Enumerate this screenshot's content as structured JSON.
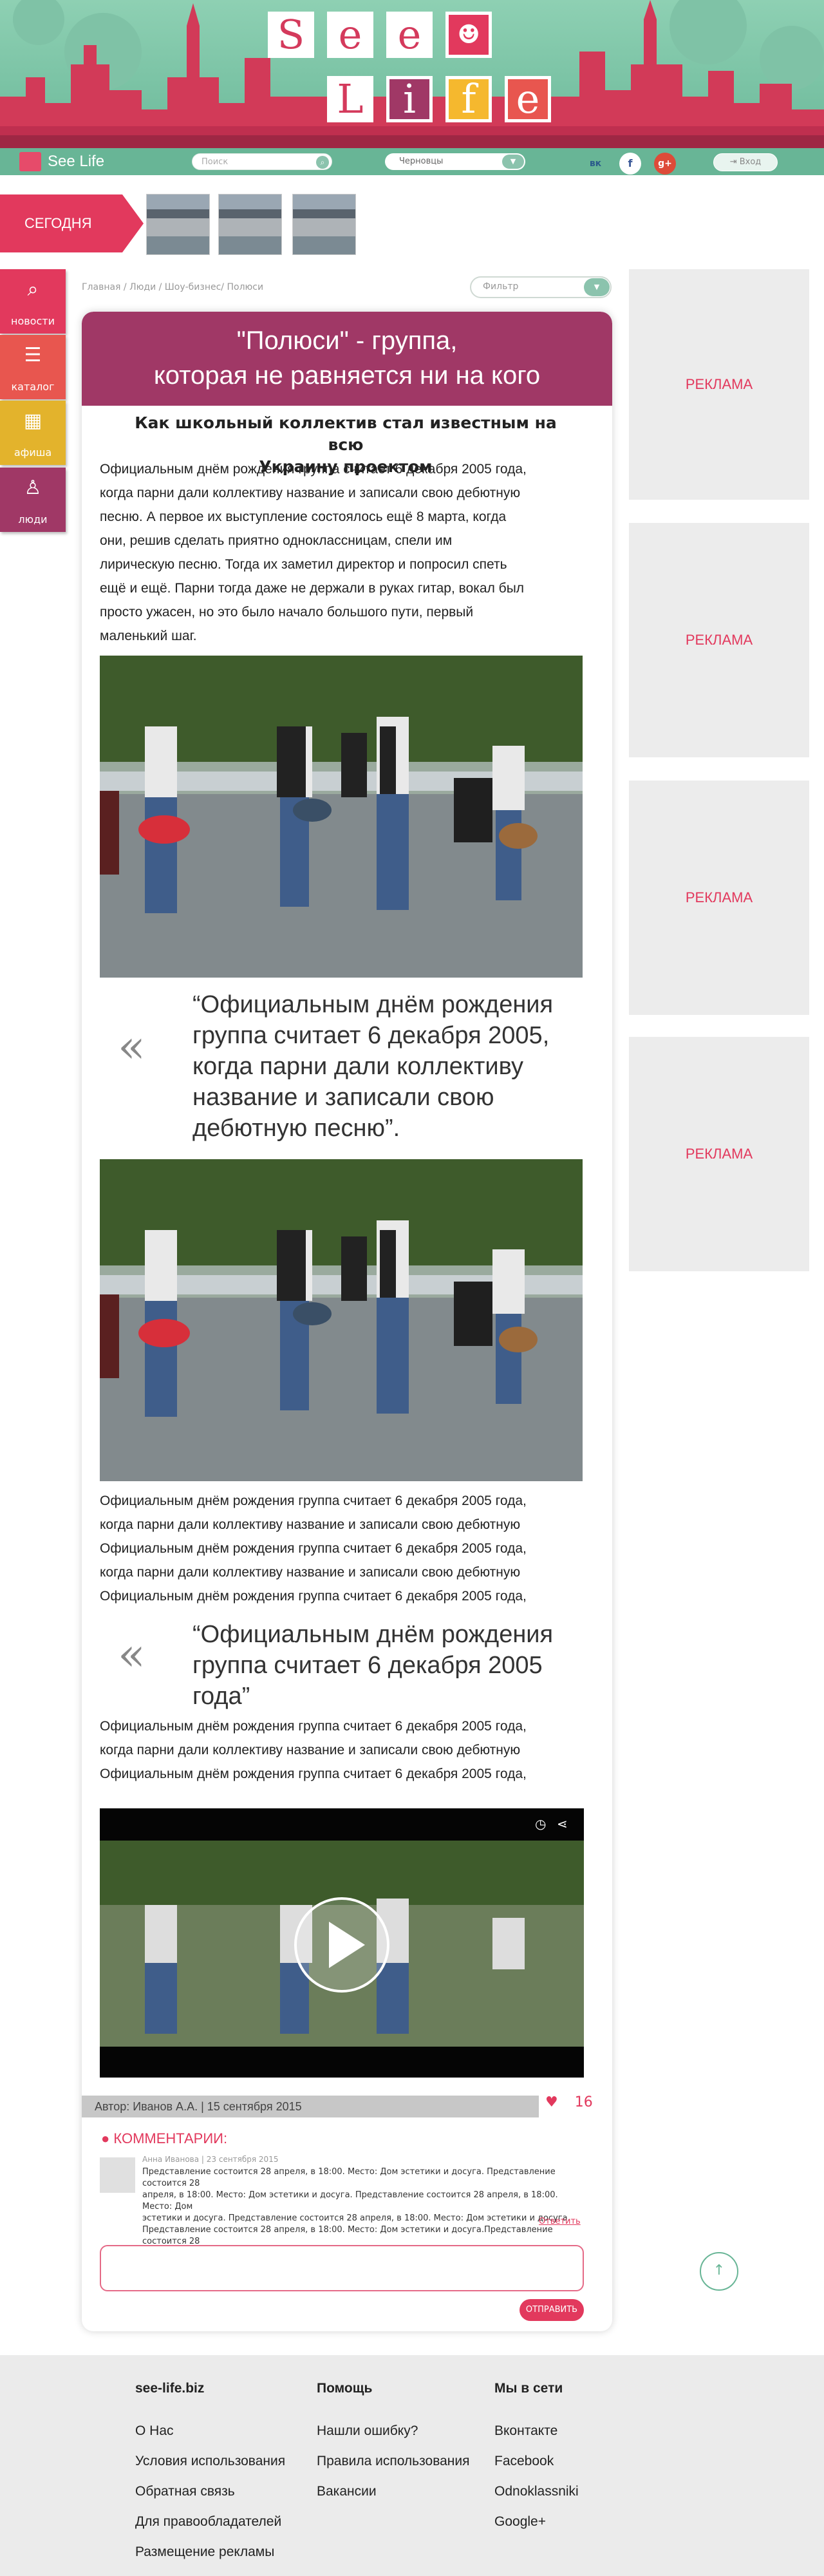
{
  "header": {
    "logo_letters": [
      "S",
      "e",
      "e",
      "L",
      "i",
      "f",
      "e"
    ],
    "brand_name": "See Life",
    "search_placeholder": "Поиск",
    "city": "Черновцы",
    "social": [
      "вк",
      "f",
      "g+"
    ],
    "login": "Вход"
  },
  "today": {
    "label": "СЕГОДНЯ"
  },
  "sidebar": [
    {
      "label": "новости",
      "icon": "search-icon"
    },
    {
      "label": "каталог",
      "icon": "list-icon"
    },
    {
      "label": "афиша",
      "icon": "calendar-icon"
    },
    {
      "label": "люди",
      "icon": "person-icon"
    }
  ],
  "breadcrumb": "Главная / Люди / Шоу-бизнес/ Полюси",
  "filter_placeholder": "Фильтр",
  "article": {
    "title": "\"Полюси\" - группа,\nкоторая не равняется ни на кого",
    "subtitle": "Как школьный коллектив стал известным на всю\nУкраину проектом",
    "para1": "Официальным днём рождения группа считает 6 декабря 2005 года,\nкогда парни дали коллективу название и записали свою дебютную\nпесню. А первое их выступление состоялось ещё 8 марта, когда\nони, решив сделать приятно одноклассницам, спели им\nлирическую песню. Тогда их заметил директор и попросил спеть\nещё и ещё. Парни тогда даже не держали в руках гитар, вокал был\nпросто ужасен, но это было начало большого пути, первый\nмаленький шаг.",
    "quote1": "“Официальным днём рождения\nгруппа считает 6 декабря 2005,\nкогда парни дали коллективу\nназвание и записали свою\nдебютную песню”.",
    "para2": "Официальным днём рождения группа считает 6 декабря 2005 года,\nкогда парни дали коллективу название и записали свою дебютную\nОфициальным днём рождения группа считает 6 декабря 2005 года,\nкогда парни дали коллективу название и записали свою дебютную\nОфициальным днём рождения группа считает 6 декабря 2005 года,",
    "quote2": "“Официальным днём рождения\nгруппа считает 6 декабря 2005\nгода”",
    "para3": "Официальным днём рождения группа считает 6 декабря 2005 года,\nкогда парни дали коллективу название и записали свою дебютную\nОфициальным днём рождения группа считает 6 декабря 2005 года,",
    "quote_glyph": "«",
    "author": "Автор: Иванов А.А. | 15 сентября 2015",
    "likes": "16"
  },
  "comments": {
    "title": "КОММЕНТАРИИ:",
    "meta": "Анна Иванова | 23 сентября 2015",
    "text": "Представление состоится 28 апреля, в 18:00. Место: Дом эстетики и досуга. Представление состоится 28\nапреля, в 18:00. Место: Дом эстетики и досуга. Представление состоится 28 апреля, в 18:00. Место: Дом\nэстетики и досуга. Представление состоится 28 апреля, в 18:00. Место: Дом эстетики и досуга.\nПредставление состоится 28 апреля, в 18:00. Место: Дом эстетики и досуга.Представление состоится 28",
    "reply": "Ответить",
    "send": "ОТПРАВИТЬ"
  },
  "ads": [
    "РЕКЛАМА",
    "РЕКЛАМА",
    "РЕКЛАМА",
    "РЕКЛАМА"
  ],
  "footer": {
    "col1": {
      "title": "see-life.biz",
      "links": [
        "О Нас",
        "Условия использования",
        "Обратная связь",
        "Для правообладателей",
        "Размещение рекламы"
      ]
    },
    "col2": {
      "title": "Помощь",
      "links": [
        "Нашли ошибку?",
        "Правила использования",
        "Вакансии"
      ]
    },
    "col3": {
      "title": "Мы в сети",
      "links": [
        "Вконтакте",
        "Facebook",
        "Odnoklassniki",
        "Google+"
      ]
    }
  },
  "colors": {
    "brand_green": "#68b596",
    "accent_pink": "#e2395d",
    "title_band": "#a03866"
  }
}
